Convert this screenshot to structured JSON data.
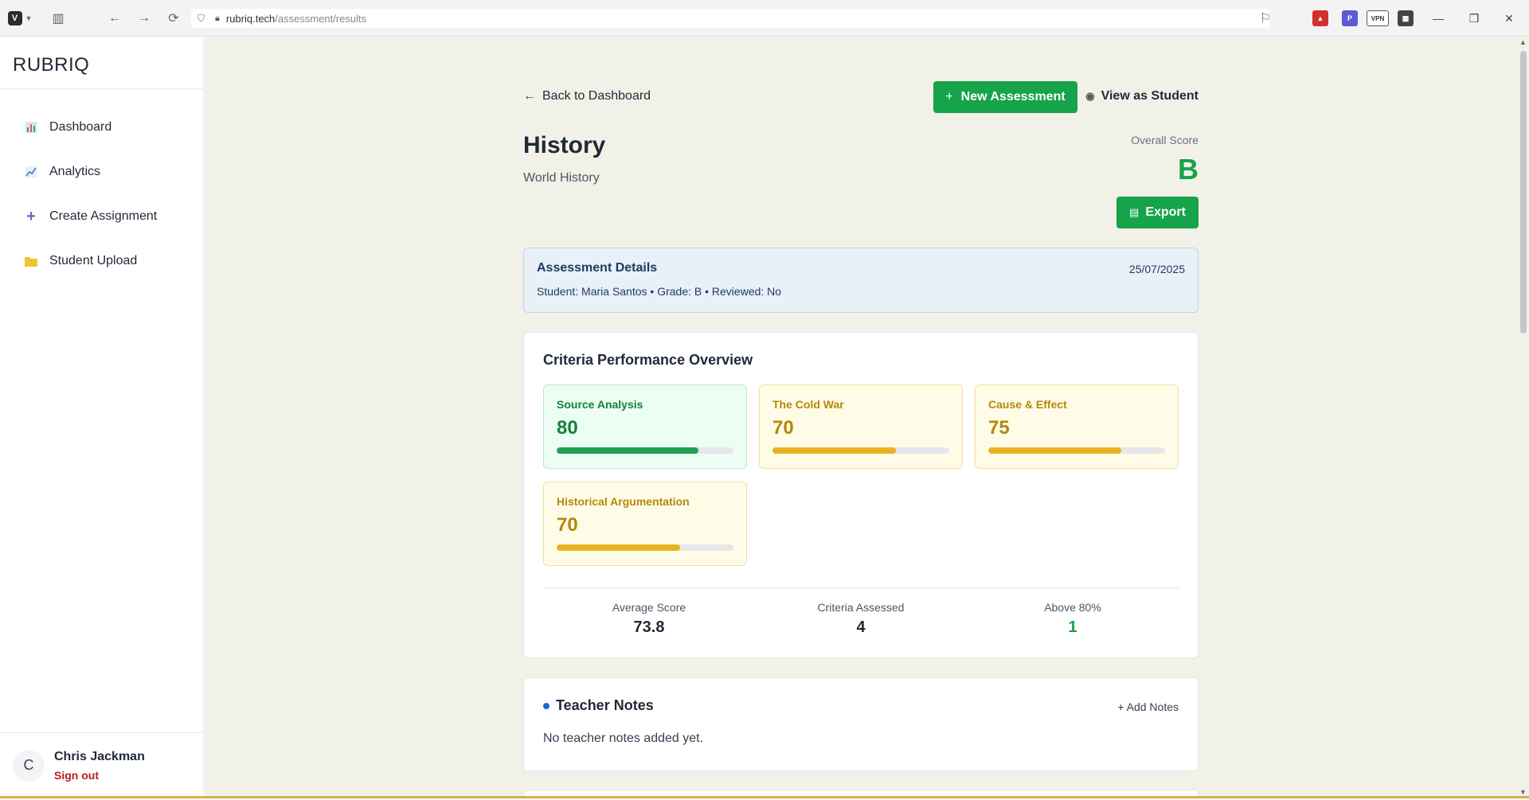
{
  "browser": {
    "url_host": "rubriq.tech",
    "url_path": "/assessment/results"
  },
  "sidebar": {
    "brand": "RUBRIQ",
    "items": [
      {
        "label": "Dashboard",
        "icon": "bar-chart-icon"
      },
      {
        "label": "Analytics",
        "icon": "line-chart-icon"
      },
      {
        "label": "Create Assignment",
        "icon": "plus-icon"
      },
      {
        "label": "Student Upload",
        "icon": "folder-icon"
      }
    ],
    "user": {
      "initial": "C",
      "name": "Chris Jackman",
      "sign_out": "Sign out"
    }
  },
  "header": {
    "back_label": "Back to Dashboard",
    "new_assessment_label": "New Assessment",
    "view_as_student_label": "View as Student",
    "title": "History",
    "subtitle": "World History",
    "overall_label": "Overall Score",
    "overall_grade": "B",
    "export_label": "Export"
  },
  "details": {
    "title": "Assessment Details",
    "date": "25/07/2025",
    "meta": "Student: Maria Santos • Grade: B • Reviewed: No"
  },
  "performance": {
    "title": "Criteria Performance Overview",
    "criteria": [
      {
        "name": "Source Analysis",
        "score": "80",
        "fraction": 0.8,
        "tone": "green"
      },
      {
        "name": "The Cold War",
        "score": "70",
        "fraction": 0.7,
        "tone": "yellow"
      },
      {
        "name": "Cause & Effect",
        "score": "75",
        "fraction": 0.75,
        "tone": "yellow"
      },
      {
        "name": "Historical Argumentation",
        "score": "70",
        "fraction": 0.7,
        "tone": "yellow"
      }
    ],
    "stats": [
      {
        "label": "Average Score",
        "value": "73.8"
      },
      {
        "label": "Criteria Assessed",
        "value": "4"
      },
      {
        "label": "Above 80%",
        "value": "1"
      }
    ]
  },
  "notes": {
    "title": "Teacher Notes",
    "add_label": "+ Add Notes",
    "empty_text": "No teacher notes added yet."
  },
  "colors": {
    "accent_green": "#16a34a",
    "warning_yellow": "#e6b422",
    "main_bg": "#f2f1e7"
  }
}
